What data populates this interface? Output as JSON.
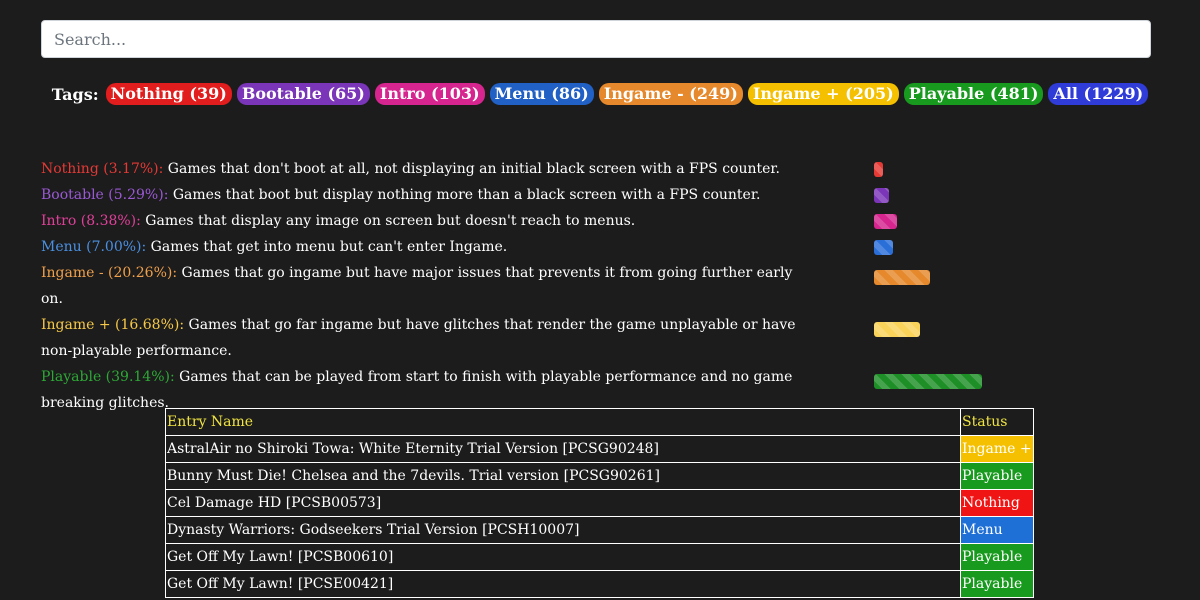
{
  "search": {
    "placeholder": "Search..."
  },
  "tags_label": "Tags:",
  "tags": [
    {
      "label": "Nothing (39)",
      "bg": "#e11d1d",
      "fg": "#ffffff"
    },
    {
      "label": "Bootable (65)",
      "bg": "#7b35b8",
      "fg": "#ffffff"
    },
    {
      "label": "Intro (103)",
      "bg": "#d6258f",
      "fg": "#ffffff"
    },
    {
      "label": "Menu (86)",
      "bg": "#2160c4",
      "fg": "#ffffff"
    },
    {
      "label": "Ingame - (249)",
      "bg": "#e5892c",
      "fg": "#ffffff"
    },
    {
      "label": "Ingame + (205)",
      "bg": "#f4c000",
      "fg": "#ffffff"
    },
    {
      "label": "Playable (481)",
      "bg": "#189a1e",
      "fg": "#ffffff"
    },
    {
      "label": "All (1229)",
      "bg": "#2f3cd8",
      "fg": "#ffffff"
    }
  ],
  "legend": [
    {
      "name": "Nothing (3.17%):",
      "desc": " Games that don't boot at all, not displaying an initial black screen with a FPS counter.",
      "color": "#e53935",
      "bar_color": "#e53935",
      "percent": 3.17
    },
    {
      "name": "Bootable (5.29%):",
      "desc": " Games that boot but display nothing more than a black screen with a FPS counter.",
      "color": "#9b59d6",
      "bar_color": "#7b35b8",
      "percent": 5.29
    },
    {
      "name": "Intro (8.38%):",
      "desc": " Games that display any image on screen but doesn't reach to menus.",
      "color": "#e0409a",
      "bar_color": "#d6258f",
      "percent": 8.38
    },
    {
      "name": "Menu (7.00%):",
      "desc": " Games that get into menu but can't enter Ingame.",
      "color": "#4a90e2",
      "bar_color": "#2a6fd8",
      "percent": 7.0
    },
    {
      "name": "Ingame - (20.26%):",
      "desc": " Games that go ingame but have major issues that prevents it from going further early on.",
      "color": "#f0a04b",
      "bar_color": "#e5892c",
      "percent": 20.26
    },
    {
      "name": "Ingame + (16.68%):",
      "desc": " Games that go far ingame but have glitches that render the game unplayable or have non-playable performance.",
      "color": "#f7c948",
      "bar_color": "#f9d35a",
      "percent": 16.68
    },
    {
      "name": "Playable (39.14%):",
      "desc": " Games that can be played from start to finish with playable performance and no game breaking glitches.",
      "color": "#2ea836",
      "bar_color": "#1e8f26",
      "percent": 39.14
    }
  ],
  "table": {
    "headers": {
      "name": "Entry Name",
      "status": "Status"
    },
    "rows": [
      {
        "name": "AstralAir no Shiroki Towa: White Eternity Trial Version [PCSG90248]",
        "status": "Ingame +",
        "status_bg": "#f4c000"
      },
      {
        "name": "Bunny Must Die! Chelsea and the 7devils. Trial version [PCSG90261]",
        "status": "Playable",
        "status_bg": "#189a1e"
      },
      {
        "name": "Cel Damage HD [PCSB00573]",
        "status": "Nothing",
        "status_bg": "#f01414"
      },
      {
        "name": "Dynasty Warriors: Godseekers Trial Version [PCSH10007]",
        "status": "Menu",
        "status_bg": "#1e6fd6"
      },
      {
        "name": "Get Off My Lawn! [PCSB00610]",
        "status": "Playable",
        "status_bg": "#189a1e"
      },
      {
        "name": "Get Off My Lawn! [PCSE00421]",
        "status": "Playable",
        "status_bg": "#189a1e"
      }
    ]
  }
}
